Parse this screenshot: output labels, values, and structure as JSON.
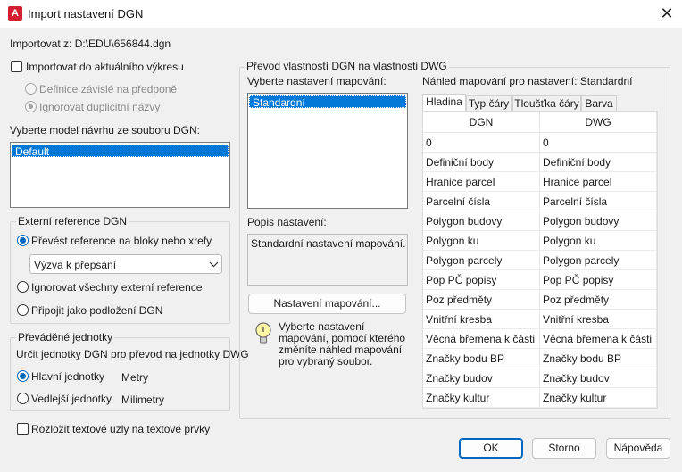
{
  "window": {
    "title": "Import nastavení DGN",
    "app_icon_letter": "A",
    "close_glyph": "✕"
  },
  "import_from": "Importovat z: D:\\EDU\\656844.dgn",
  "import_current": {
    "label": "Importovat do aktuálního výkresu",
    "checked": false,
    "opt_definition": "Definice závislé na předponě",
    "opt_ignore_dup": "Ignorovat duplicitní názvy"
  },
  "model": {
    "label": "Vyberte model návrhu ze souboru DGN:",
    "items": [
      "Default"
    ]
  },
  "xref": {
    "title": "Externí reference DGN",
    "opt_convert": "Převést reference na bloky nebo xrefy",
    "combo_value": "Výzva k přepsání",
    "opt_ignore": "Ignorovat všechny externí reference",
    "opt_attach": "Připojit jako podložení DGN"
  },
  "units": {
    "title": "Převáděné jednotky",
    "desc": "Určit jednotky DGN pro převod na jednotky DWG",
    "opt_main": "Hlavní jednotky",
    "main_value": "Metry",
    "opt_sub": "Vedlejší jednotky",
    "sub_value": "Milimetry"
  },
  "explode_text": "Rozložit textové uzly na textové prvky",
  "mapping": {
    "group_title": "Převod vlastností DGN na vlastnosti DWG",
    "select_label": "Vyberte nastavení mapování:",
    "items": [
      "Standardní"
    ],
    "desc_label": "Popis nastavení:",
    "desc_text": "Standardní nastavení mapování.",
    "setup_button": "Nastavení mapování...",
    "hint": "Vyberte nastavení mapování, pomocí kterého změníte náhled mapování pro vybraný soubor."
  },
  "preview": {
    "label": "Náhled mapování pro nastavení: Standardní",
    "tabs": [
      "Hladina",
      "Typ čáry",
      "Tloušťka čáry",
      "Barva"
    ],
    "col_dgn": "DGN",
    "col_dwg": "DWG",
    "rows": [
      [
        "0",
        "0"
      ],
      [
        "Definiční body",
        "Definiční body"
      ],
      [
        "Hranice parcel",
        "Hranice parcel"
      ],
      [
        "Parcelní čísla",
        "Parcelní čísla"
      ],
      [
        "Polygon budovy",
        "Polygon budovy"
      ],
      [
        "Polygon ku",
        "Polygon ku"
      ],
      [
        "Polygon parcely",
        "Polygon parcely"
      ],
      [
        "Pop  PČ popisy",
        "Pop  PČ popisy"
      ],
      [
        "Poz předměty",
        "Poz předměty"
      ],
      [
        "Vnitřní kresba",
        "Vnitřní kresba"
      ],
      [
        "Věcná břemena k části",
        "Věcná břemena k části"
      ],
      [
        "Značky bodu BP",
        "Značky bodu BP"
      ],
      [
        "Značky budov",
        "Značky budov"
      ],
      [
        "Značky kultur",
        "Značky kultur"
      ]
    ]
  },
  "buttons": {
    "ok": "OK",
    "cancel": "Storno",
    "help": "Nápověda"
  }
}
